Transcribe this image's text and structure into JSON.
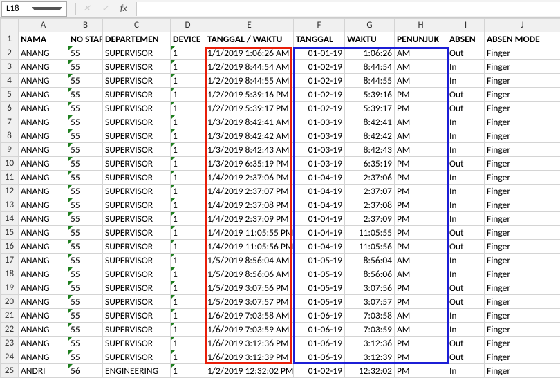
{
  "nameBox": "L18",
  "fx": {
    "cancel": "✕",
    "confirm": "✓",
    "fx": "fx"
  },
  "columns": [
    "A",
    "B",
    "C",
    "D",
    "E",
    "F",
    "G",
    "H",
    "I",
    "J"
  ],
  "headers": {
    "A": "NAMA",
    "B": "NO STAF",
    "C": "DEPARTEMEN",
    "D": "DEVICE",
    "E": "TANGGAL / WAKTU",
    "F": "TANGGAL",
    "G": "WAKTU",
    "H": "PENUNJUK",
    "I": "ABSEN",
    "J": "ABSEN MODE"
  },
  "rows": [
    {
      "r": 2,
      "A": "ANANG",
      "B": "55",
      "C": "SUPERVISOR",
      "D": "1",
      "E": "1/1/2019 1:06:26 AM",
      "F": "01-01-19",
      "G": "1:06:26",
      "H": "AM",
      "I": "Out",
      "J": "Finger"
    },
    {
      "r": 3,
      "A": "ANANG",
      "B": "55",
      "C": "SUPERVISOR",
      "D": "1",
      "E": "1/2/2019 8:44:54 AM",
      "F": "01-02-19",
      "G": "8:44:54",
      "H": "AM",
      "I": "In",
      "J": "Finger"
    },
    {
      "r": 4,
      "A": "ANANG",
      "B": "55",
      "C": "SUPERVISOR",
      "D": "1",
      "E": "1/2/2019 8:44:55 AM",
      "F": "01-02-19",
      "G": "8:44:55",
      "H": "AM",
      "I": "In",
      "J": "Finger"
    },
    {
      "r": 5,
      "A": "ANANG",
      "B": "55",
      "C": "SUPERVISOR",
      "D": "1",
      "E": "1/2/2019 5:39:16 PM",
      "F": "01-02-19",
      "G": "5:39:16",
      "H": "PM",
      "I": "Out",
      "J": "Finger"
    },
    {
      "r": 6,
      "A": "ANANG",
      "B": "55",
      "C": "SUPERVISOR",
      "D": "1",
      "E": "1/2/2019 5:39:17 PM",
      "F": "01-02-19",
      "G": "5:39:17",
      "H": "PM",
      "I": "Out",
      "J": "Finger"
    },
    {
      "r": 7,
      "A": "ANANG",
      "B": "55",
      "C": "SUPERVISOR",
      "D": "1",
      "E": "1/3/2019 8:42:41 AM",
      "F": "01-03-19",
      "G": "8:42:41",
      "H": "AM",
      "I": "In",
      "J": "Finger"
    },
    {
      "r": 8,
      "A": "ANANG",
      "B": "55",
      "C": "SUPERVISOR",
      "D": "1",
      "E": "1/3/2019 8:42:42 AM",
      "F": "01-03-19",
      "G": "8:42:42",
      "H": "AM",
      "I": "In",
      "J": "Finger"
    },
    {
      "r": 9,
      "A": "ANANG",
      "B": "55",
      "C": "SUPERVISOR",
      "D": "1",
      "E": "1/3/2019 8:42:43 AM",
      "F": "01-03-19",
      "G": "8:42:43",
      "H": "AM",
      "I": "In",
      "J": "Finger"
    },
    {
      "r": 10,
      "A": "ANANG",
      "B": "55",
      "C": "SUPERVISOR",
      "D": "1",
      "E": "1/3/2019 6:35:19 PM",
      "F": "01-03-19",
      "G": "6:35:19",
      "H": "PM",
      "I": "Out",
      "J": "Finger"
    },
    {
      "r": 11,
      "A": "ANANG",
      "B": "55",
      "C": "SUPERVISOR",
      "D": "1",
      "E": "1/4/2019 2:37:06 PM",
      "F": "01-04-19",
      "G": "2:37:06",
      "H": "PM",
      "I": "In",
      "J": "Finger"
    },
    {
      "r": 12,
      "A": "ANANG",
      "B": "55",
      "C": "SUPERVISOR",
      "D": "1",
      "E": "1/4/2019 2:37:07 PM",
      "F": "01-04-19",
      "G": "2:37:07",
      "H": "PM",
      "I": "In",
      "J": "Finger"
    },
    {
      "r": 13,
      "A": "ANANG",
      "B": "55",
      "C": "SUPERVISOR",
      "D": "1",
      "E": "1/4/2019 2:37:08 PM",
      "F": "01-04-19",
      "G": "2:37:08",
      "H": "PM",
      "I": "In",
      "J": "Finger"
    },
    {
      "r": 14,
      "A": "ANANG",
      "B": "55",
      "C": "SUPERVISOR",
      "D": "1",
      "E": "1/4/2019 2:37:09 PM",
      "F": "01-04-19",
      "G": "2:37:09",
      "H": "PM",
      "I": "In",
      "J": "Finger"
    },
    {
      "r": 15,
      "A": "ANANG",
      "B": "55",
      "C": "SUPERVISOR",
      "D": "1",
      "E": "1/4/2019 11:05:55 PM",
      "F": "01-04-19",
      "G": "11:05:55",
      "H": "PM",
      "I": "Out",
      "J": "Finger"
    },
    {
      "r": 16,
      "A": "ANANG",
      "B": "55",
      "C": "SUPERVISOR",
      "D": "1",
      "E": "1/4/2019 11:05:56 PM",
      "F": "01-04-19",
      "G": "11:05:56",
      "H": "PM",
      "I": "Out",
      "J": "Finger"
    },
    {
      "r": 17,
      "A": "ANANG",
      "B": "55",
      "C": "SUPERVISOR",
      "D": "1",
      "E": "1/5/2019 8:56:04 AM",
      "F": "01-05-19",
      "G": "8:56:04",
      "H": "AM",
      "I": "In",
      "J": "Finger"
    },
    {
      "r": 18,
      "A": "ANANG",
      "B": "55",
      "C": "SUPERVISOR",
      "D": "1",
      "E": "1/5/2019 8:56:06 AM",
      "F": "01-05-19",
      "G": "8:56:06",
      "H": "AM",
      "I": "In",
      "J": "Finger"
    },
    {
      "r": 19,
      "A": "ANANG",
      "B": "55",
      "C": "SUPERVISOR",
      "D": "1",
      "E": "1/5/2019 3:07:56 PM",
      "F": "01-05-19",
      "G": "3:07:56",
      "H": "PM",
      "I": "Out",
      "J": "Finger"
    },
    {
      "r": 20,
      "A": "ANANG",
      "B": "55",
      "C": "SUPERVISOR",
      "D": "1",
      "E": "1/5/2019 3:07:57 PM",
      "F": "01-05-19",
      "G": "3:07:57",
      "H": "PM",
      "I": "Out",
      "J": "Finger"
    },
    {
      "r": 21,
      "A": "ANANG",
      "B": "55",
      "C": "SUPERVISOR",
      "D": "1",
      "E": "1/6/2019 7:03:58 AM",
      "F": "01-06-19",
      "G": "7:03:58",
      "H": "AM",
      "I": "In",
      "J": "Finger"
    },
    {
      "r": 22,
      "A": "ANANG",
      "B": "55",
      "C": "SUPERVISOR",
      "D": "1",
      "E": "1/6/2019 7:03:59 AM",
      "F": "01-06-19",
      "G": "7:03:59",
      "H": "AM",
      "I": "In",
      "J": "Finger"
    },
    {
      "r": 23,
      "A": "ANANG",
      "B": "55",
      "C": "SUPERVISOR",
      "D": "1",
      "E": "1/6/2019 3:12:36 PM",
      "F": "01-06-19",
      "G": "3:12:36",
      "H": "PM",
      "I": "Out",
      "J": "Finger"
    },
    {
      "r": 24,
      "A": "ANANG",
      "B": "55",
      "C": "SUPERVISOR",
      "D": "1",
      "E": "1/6/2019 3:12:39 PM",
      "F": "01-06-19",
      "G": "3:12:39",
      "H": "PM",
      "I": "Out",
      "J": "Finger"
    },
    {
      "r": 25,
      "A": "ANDRI",
      "B": "56",
      "C": "ENGINEERING",
      "D": "1",
      "E": "1/2/2019 12:32:02 PM",
      "F": "01-02-19",
      "G": "12:32:02",
      "H": "PM",
      "I": "In",
      "J": "Finger"
    }
  ],
  "selectedCell": "L18",
  "selectedRow": 18
}
